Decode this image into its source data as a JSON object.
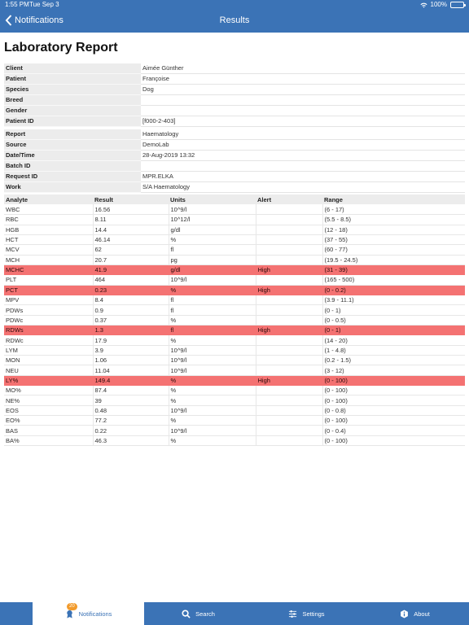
{
  "status_bar": {
    "time": "1:55 PM",
    "date": "Tue Sep 3",
    "battery": "100%"
  },
  "nav": {
    "back_label": "Notifications",
    "title": "Results"
  },
  "report": {
    "title": "Laboratory Report",
    "patient_info": [
      {
        "label": "Client",
        "value": "Aimée Günther"
      },
      {
        "label": "Patient",
        "value": "Françoise"
      },
      {
        "label": "Species",
        "value": "Dog"
      },
      {
        "label": "Breed",
        "value": ""
      },
      {
        "label": "Gender",
        "value": ""
      },
      {
        "label": "Patient ID",
        "value": "[f000-2-403]"
      }
    ],
    "report_info": [
      {
        "label": "Report",
        "value": "Haematology"
      },
      {
        "label": "Source",
        "value": "DemoLab"
      },
      {
        "label": "Date/Time",
        "value": "28-Aug-2019 13:32"
      },
      {
        "label": "Batch ID",
        "value": ""
      },
      {
        "label": "Request ID",
        "value": "MPR.ELKA"
      },
      {
        "label": "Work",
        "value": "S/A Haematology"
      }
    ],
    "results_headers": [
      "Analyte",
      "Result",
      "Units",
      "Alert",
      "Range"
    ],
    "results": [
      [
        "WBC",
        "16.56",
        "10^9/l",
        "",
        "(6 - 17)"
      ],
      [
        "RBC",
        "8.11",
        "10^12/l",
        "",
        "(5.5 - 8.5)"
      ],
      [
        "HGB",
        "14.4",
        "g/dl",
        "",
        "(12 - 18)"
      ],
      [
        "HCT",
        "46.14",
        "%",
        "",
        "(37 - 55)"
      ],
      [
        "MCV",
        "62",
        "fl",
        "",
        "(60 - 77)"
      ],
      [
        "MCH",
        "20.7",
        "pg",
        "",
        "(19.5 - 24.5)"
      ],
      [
        "MCHC",
        "41.9",
        "g/dl",
        "High",
        "(31 - 39)"
      ],
      [
        "PLT",
        "464",
        "10^9/l",
        "",
        "(165 - 500)"
      ],
      [
        "PCT",
        "0.23",
        "%",
        "High",
        "(0 - 0.2)"
      ],
      [
        "MPV",
        "8.4",
        "fl",
        "",
        "(3.9 - 11.1)"
      ],
      [
        "PDWs",
        "0.9",
        "fl",
        "",
        "(0 - 1)"
      ],
      [
        "PDWc",
        "0.37",
        "%",
        "",
        "(0 - 0.5)"
      ],
      [
        "RDWs",
        "1.3",
        "fl",
        "High",
        "(0 - 1)"
      ],
      [
        "RDWc",
        "17.9",
        "%",
        "",
        "(14 - 20)"
      ],
      [
        "LYM",
        "3.9",
        "10^9/l",
        "",
        "(1 - 4.8)"
      ],
      [
        "MON",
        "1.06",
        "10^9/l",
        "",
        "(0.2 - 1.5)"
      ],
      [
        "NEU",
        "11.04",
        "10^9/l",
        "",
        "(3 - 12)"
      ],
      [
        "LY%",
        "149.4",
        "%",
        "High",
        "(0 - 100)"
      ],
      [
        "MO%",
        "87.4",
        "%",
        "",
        "(0 - 100)"
      ],
      [
        "NE%",
        "39",
        "%",
        "",
        "(0 - 100)"
      ],
      [
        "EOS",
        "0.48",
        "10^9/l",
        "",
        "(0 - 0.8)"
      ],
      [
        "EO%",
        "77.2",
        "%",
        "",
        "(0 - 100)"
      ],
      [
        "BAS",
        "0.22",
        "10^9/l",
        "",
        "(0 - 0.4)"
      ],
      [
        "BA%",
        "46.3",
        "%",
        "",
        "(0 - 100)"
      ]
    ]
  },
  "tabbar": {
    "tabs": [
      {
        "label": "Notifications",
        "icon": "ribbon-icon",
        "active": true,
        "badge": "20"
      },
      {
        "label": "Search",
        "icon": "search-icon"
      },
      {
        "label": "Settings",
        "icon": "sliders-icon"
      },
      {
        "label": "About",
        "icon": "info-badge-icon"
      }
    ]
  },
  "colors": {
    "brand": "#3b73b6",
    "alert_row": "#f47272",
    "badge": "#f29b2c",
    "key_cell": "#ececec"
  }
}
